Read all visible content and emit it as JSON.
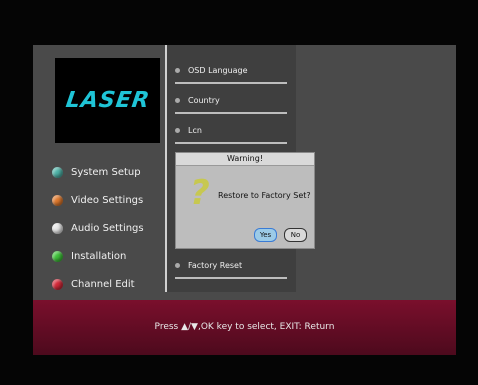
{
  "brand": {
    "logo_text": "LASER"
  },
  "left_menu": [
    {
      "label": "System Setup",
      "color": "#4fb3a8"
    },
    {
      "label": "Video Settings",
      "color": "#e07a2e"
    },
    {
      "label": "Audio Settings",
      "color": "#e8e8e8"
    },
    {
      "label": "Installation",
      "color": "#3fc23a"
    },
    {
      "label": "Channel Edit",
      "color": "#d42a3a"
    }
  ],
  "panel_items": [
    {
      "label": "OSD Language"
    },
    {
      "label": "Country"
    },
    {
      "label": "Lcn"
    },
    {
      "label": "Factory Reset"
    }
  ],
  "dialog": {
    "title": "Warning!",
    "message": "Restore to Factory Set?",
    "yes_label": "Yes",
    "no_label": "No"
  },
  "footer": {
    "hint": "Press ▲/▼,OK key to select, EXIT: Return"
  }
}
